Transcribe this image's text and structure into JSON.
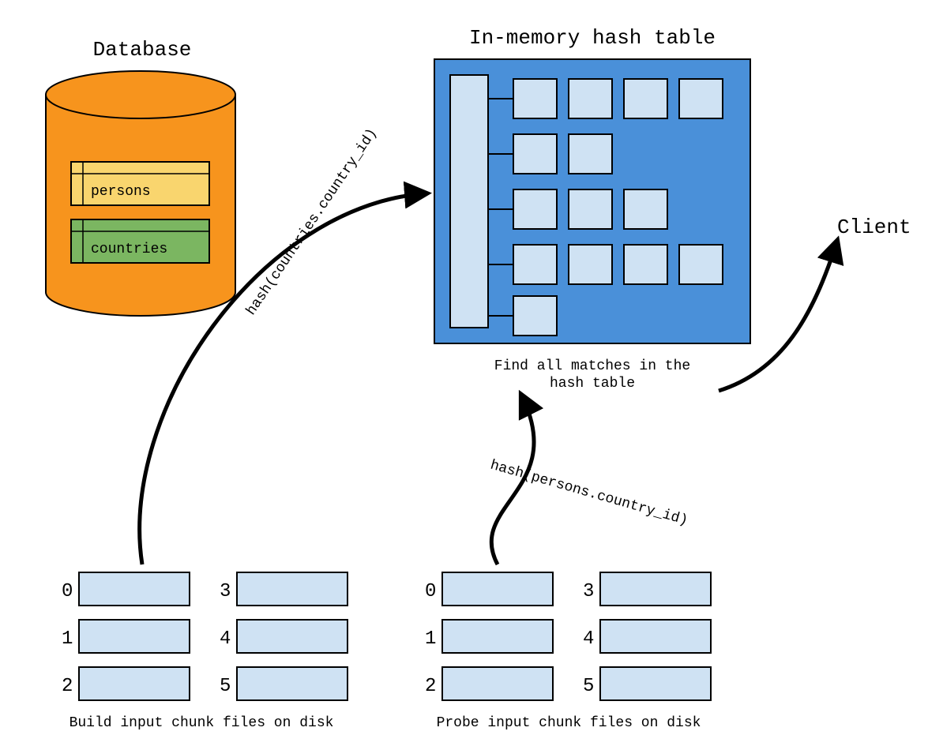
{
  "labels": {
    "database_title": "Database",
    "hash_table_title": "In-memory hash table",
    "client": "Client",
    "persons_table": "persons",
    "countries_table": "countries",
    "build_hash_fn": "hash(countries.country_id)",
    "probe_hash_fn": "hash(persons.country_id)",
    "find_matches_l1": "Find all matches in the",
    "find_matches_l2": "hash table",
    "build_caption": "Build input chunk files on disk",
    "probe_caption": "Probe input chunk files on disk"
  },
  "chunks": {
    "build": [
      "0",
      "1",
      "2",
      "3",
      "4",
      "5"
    ],
    "probe": [
      "0",
      "1",
      "2",
      "3",
      "4",
      "5"
    ]
  },
  "colors": {
    "db_orange": "#f7941d",
    "persons_fill": "#f9d56e",
    "countries_fill": "#7bb661",
    "hash_outer": "#4a90d9",
    "light_blue": "#cfe2f3",
    "stroke": "#000000"
  }
}
